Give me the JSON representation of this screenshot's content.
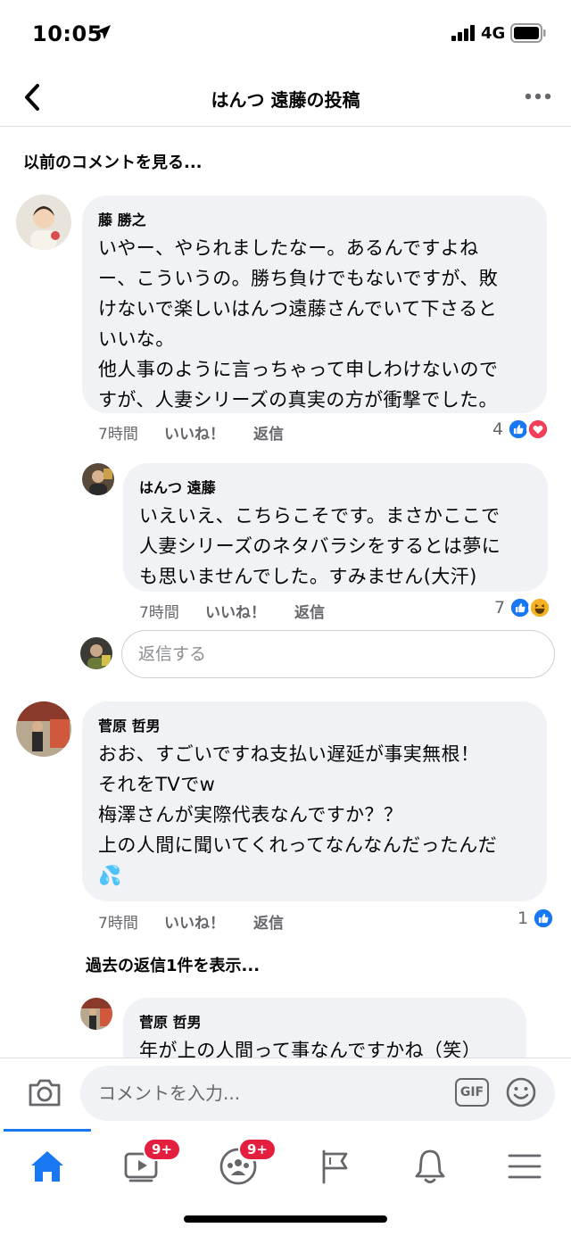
{
  "status_bar": {
    "time": "10:05",
    "network": "4G"
  },
  "header": {
    "title": "はんつ 遠藤の投稿"
  },
  "previous_comments_label": "以前のコメントを見る...",
  "comments": [
    {
      "author": "藤 勝之",
      "lines": [
        "いやー、やられましたなー。あるんですよね",
        "ー、こういうの。勝ち負けでもないですが、敗",
        "けないで楽しいはんつ遠藤さんでいて下さると",
        "いいな。",
        "他人事のように言っちゃって申しわけないので",
        "すが、人妻シリーズの真実の方が衝撃でした。"
      ],
      "time": "7時間",
      "like": "いいね！",
      "reply": "返信",
      "reaction_count": "4",
      "reactions": [
        "like",
        "love"
      ]
    },
    {
      "author": "はんつ 遠藤",
      "lines": [
        "いえいえ、こちらこそです。まさかここで",
        "人妻シリーズのネタバラシをするとは夢に",
        "も思いませんでした。すみません(大汗)"
      ],
      "time": "7時間",
      "like": "いいね！",
      "reply": "返信",
      "reaction_count": "7",
      "reactions": [
        "like",
        "haha"
      ]
    },
    {
      "author": "菅原 哲男",
      "lines": [
        "おお、すごいですね支払い遅延が事実無根！",
        "それをTVでw",
        "梅澤さんが実際代表なんですか？？",
        "上の人間に聞いてくれってなんなんだったんだ",
        "💦"
      ],
      "time": "7時間",
      "like": "いいね！",
      "reply": "返信",
      "reaction_count": "1",
      "reactions": [
        "like"
      ]
    },
    {
      "author": "菅原 哲男",
      "lines": [
        "年が上の人間って事なんですかね（笑）"
      ]
    }
  ],
  "reply_input": {
    "placeholder": "返信する"
  },
  "show_replies_label": "過去の返信1件を表示...",
  "composer": {
    "placeholder": "コメントを入力...",
    "gif": "GIF"
  },
  "tabbar": {
    "watch_badge": "9+",
    "groups_badge": "9+"
  },
  "colors": {
    "accent": "#1877f2",
    "bubble": "#f0f2f5",
    "badge": "#e41e3f",
    "love": "#f33e58",
    "haha": "#f7b125"
  }
}
